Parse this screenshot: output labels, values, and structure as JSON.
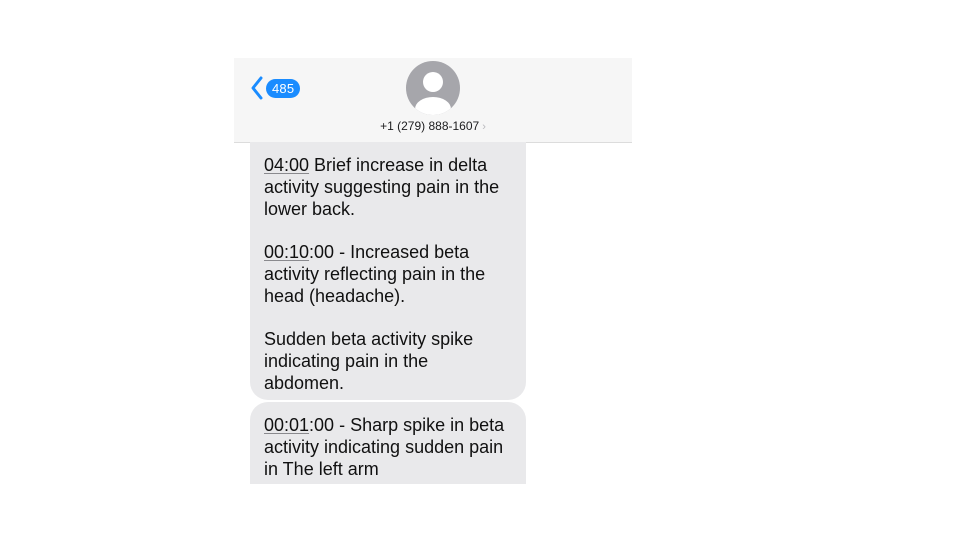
{
  "header": {
    "back_badge": "485",
    "contact_number": "+1 (279) 888-1607",
    "icons": {
      "back": "chevron-left-icon",
      "avatar": "person-silhouette-icon",
      "disclosure": "chevron-right-icon"
    },
    "colors": {
      "accent": "#1a8cff",
      "header_bg": "#f6f6f6",
      "bubble_bg": "#e9e9eb",
      "avatar_bg": "#a6a6ab"
    }
  },
  "messages": [
    {
      "paragraphs": [
        {
          "timestamp": "04:00",
          "text": " Brief increase in delta activity suggesting pain in the lower back."
        },
        {
          "timestamp": "00:10",
          "text": ":00 - Increased beta activity reflecting pain in the head (headache)."
        },
        {
          "timestamp": "",
          "text": "Sudden beta activity spike indicating pain in the abdomen."
        }
      ]
    },
    {
      "paragraphs": [
        {
          "timestamp": "00:01",
          "text": ":00 - Sharp spike in beta activity indicating sudden pain in The left arm"
        }
      ]
    }
  ]
}
